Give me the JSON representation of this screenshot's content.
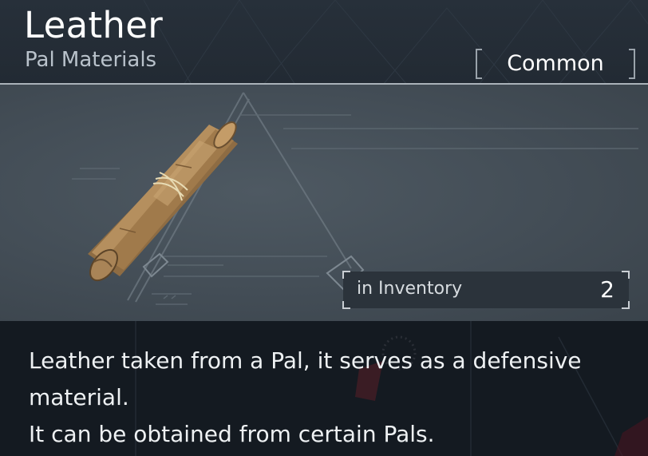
{
  "item": {
    "name": "Leather",
    "category": "Pal Materials",
    "rarity": "Common",
    "icon": "leather-roll-icon"
  },
  "inventory": {
    "label": "in Inventory",
    "count": "2"
  },
  "description": {
    "line1": "Leather taken from a Pal, it serves as a defensive",
    "line2": "material.",
    "line3": "It can be obtained from certain Pals."
  },
  "colors": {
    "header_bg": "#27303a",
    "art_bg": "#434d56",
    "desc_bg": "#141a21",
    "leather": "#b08a5a",
    "text": "#ffffff",
    "subtext": "#b9c2cb"
  }
}
